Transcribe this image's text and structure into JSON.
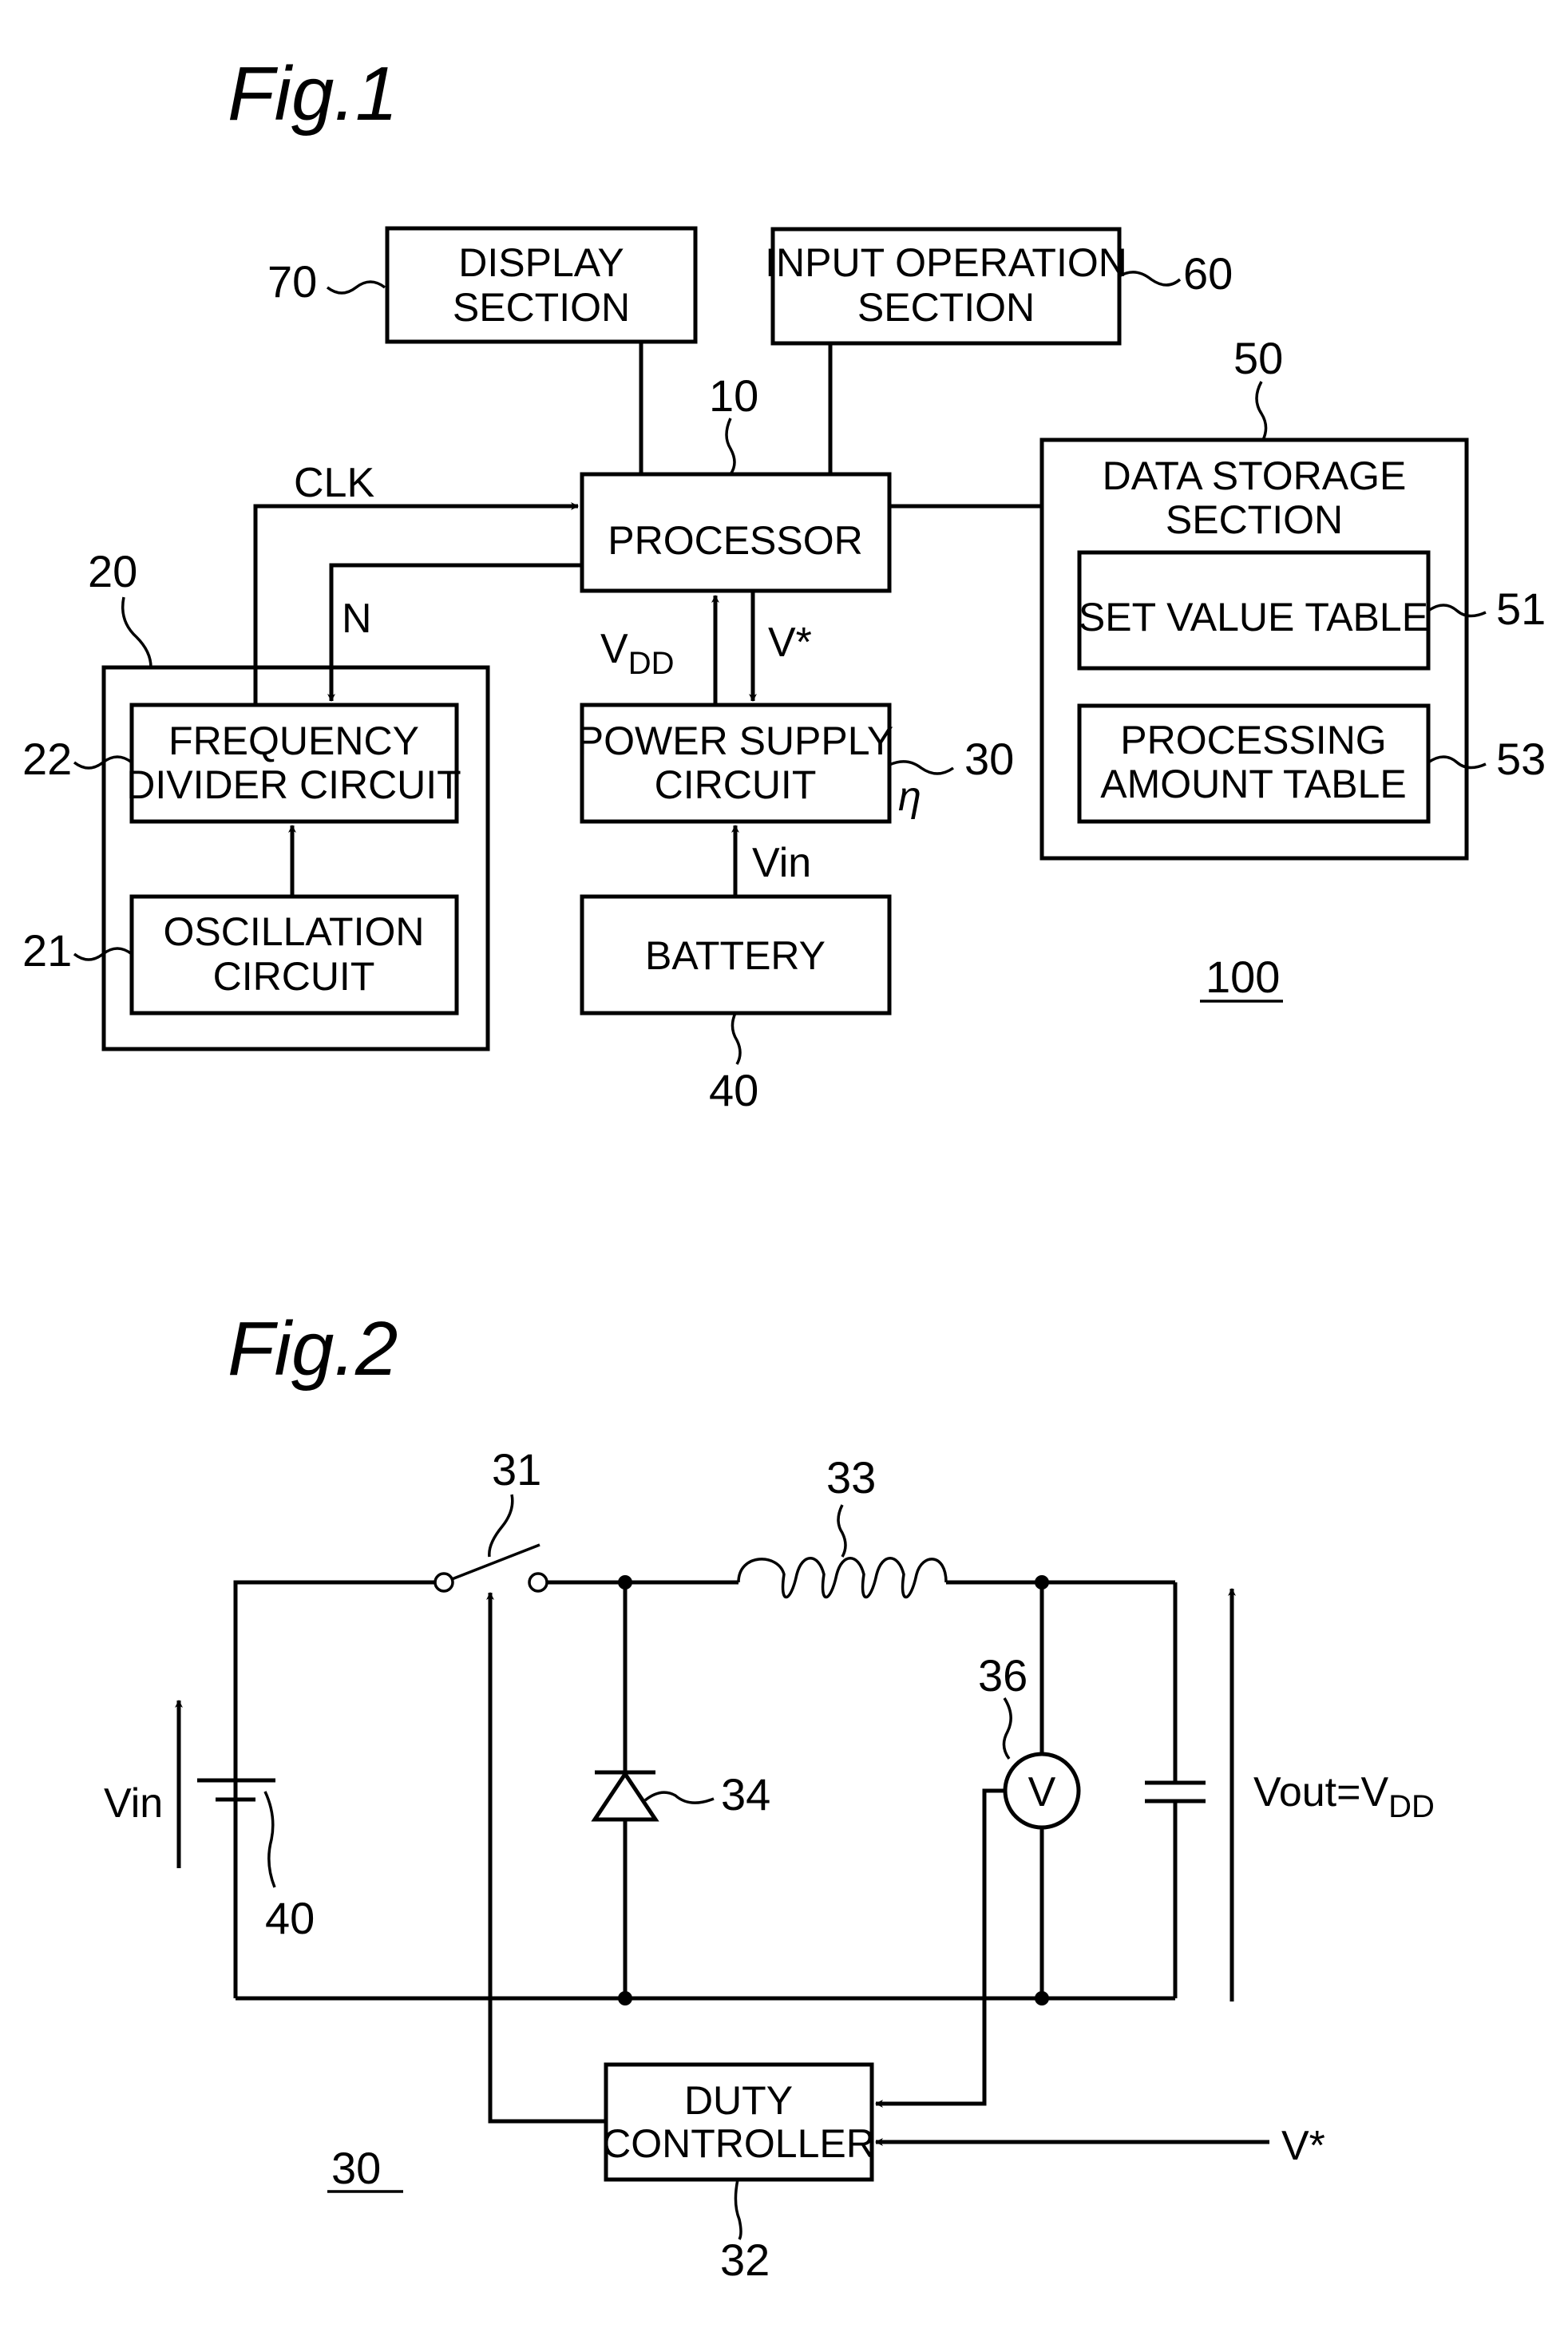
{
  "fig1": {
    "title": "Fig.1",
    "system_ref": "100",
    "blocks": {
      "display": {
        "line1": "DISPLAY",
        "line2": "SECTION",
        "ref": "70"
      },
      "input": {
        "line1": "INPUT  OPERATION",
        "line2": "SECTION",
        "ref": "60"
      },
      "processor": {
        "label": "PROCESSOR",
        "ref": "10"
      },
      "storage": {
        "line1": "DATA  STORAGE",
        "line2": "SECTION",
        "ref": "50"
      },
      "set_value": {
        "label": "SET  VALUE  TABLE",
        "ref": "51"
      },
      "processing_amount": {
        "line1": "PROCESSING",
        "line2": "AMOUNT  TABLE",
        "ref": "53"
      },
      "clock_unit": {
        "ref": "20"
      },
      "freq_divider": {
        "line1": "FREQUENCY",
        "line2": "DIVIDER  CIRCUIT",
        "ref": "22"
      },
      "oscillation": {
        "line1": "OSCILLATION",
        "line2": "CIRCUIT",
        "ref": "21"
      },
      "power_supply": {
        "line1": "POWER  SUPPLY",
        "line2": "CIRCUIT",
        "ref": "30",
        "eta": "η"
      },
      "battery": {
        "label": "BATTERY",
        "ref": "40"
      }
    },
    "signals": {
      "clk": "CLK",
      "n": "N",
      "vdd_main": "V",
      "vdd_sub": "DD",
      "vstar": "V*",
      "vin": "Vin"
    }
  },
  "fig2": {
    "title": "Fig.2",
    "circuit_ref": "30",
    "components": {
      "switch": "31",
      "duty_controller": {
        "line1": "DUTY",
        "line2": "CONTROLLER",
        "ref": "32"
      },
      "inductor": "33",
      "diode": "34",
      "voltmeter": {
        "ref": "36",
        "symbol": "V"
      },
      "battery": "40"
    },
    "signals": {
      "vin": "Vin",
      "vout_main": "Vout=V",
      "vout_sub": "DD",
      "vstar": "V*"
    }
  }
}
